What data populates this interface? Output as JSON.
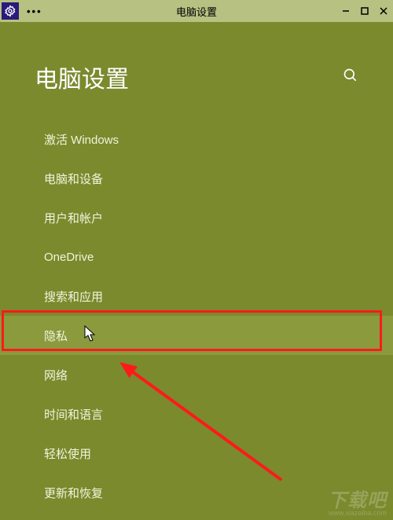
{
  "window": {
    "title": "电脑设置",
    "menu_dots": "•••"
  },
  "header": {
    "page_title": "电脑设置"
  },
  "menu": {
    "items": [
      {
        "label": "激活 Windows",
        "selected": false
      },
      {
        "label": "电脑和设备",
        "selected": false
      },
      {
        "label": "用户和帐户",
        "selected": false
      },
      {
        "label": "OneDrive",
        "selected": false
      },
      {
        "label": "搜索和应用",
        "selected": false
      },
      {
        "label": "隐私",
        "selected": true
      },
      {
        "label": "网络",
        "selected": false
      },
      {
        "label": "时间和语言",
        "selected": false
      },
      {
        "label": "轻松使用",
        "selected": false
      },
      {
        "label": "更新和恢复",
        "selected": false
      }
    ]
  },
  "watermark": {
    "text": "下载吧",
    "url": "www.xiazaiba.com"
  },
  "annotation": {
    "highlight_index": 5
  }
}
